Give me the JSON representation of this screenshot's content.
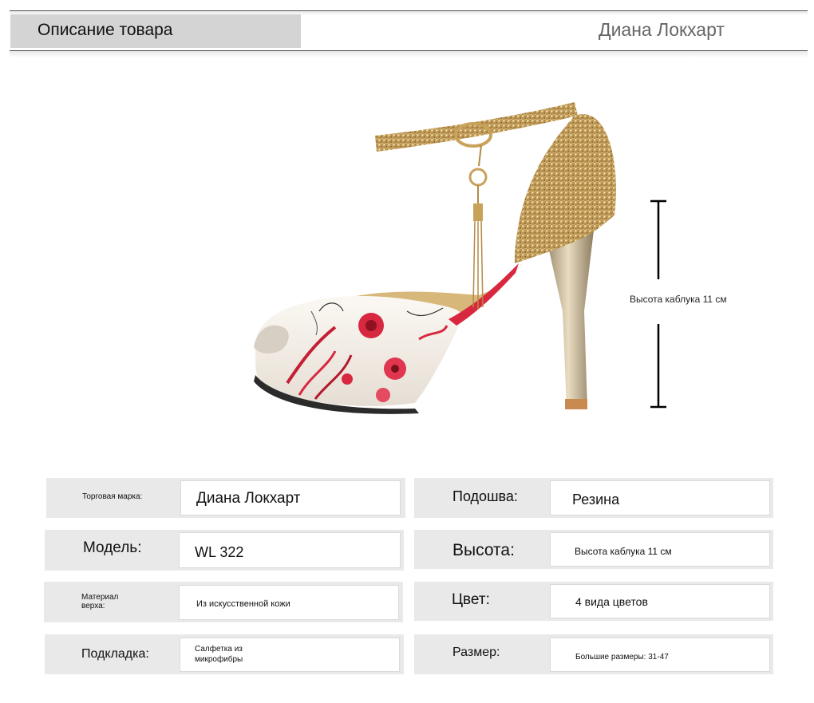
{
  "header": {
    "section_title": "Описание товара",
    "brand": "Диана Локхарт"
  },
  "product_image": {
    "heel_label": "Высота каблука 11 см",
    "colors": {
      "floral_red": "#d8283f",
      "gold_glitter": "#c9a25a",
      "base_white": "#f4efe9"
    }
  },
  "specs": {
    "brand": {
      "label": "Торговая марка:",
      "value": "Диана Локхарт"
    },
    "model": {
      "label": "Модель:",
      "value": "WL 322"
    },
    "upper": {
      "label": "Материал верха:",
      "value": "Из искусственной кожи"
    },
    "lining": {
      "label": "Подкладка:",
      "value": "Салфетка из микрофибры"
    },
    "sole": {
      "label": "Подошва:",
      "value": "Резина"
    },
    "height": {
      "label": "Высота:",
      "value": "Высота каблука 11 см"
    },
    "color": {
      "label": "Цвет:",
      "value": "4 вида цветов"
    },
    "size": {
      "label": "Размер:",
      "value": "Большие размеры: 31-47"
    }
  }
}
